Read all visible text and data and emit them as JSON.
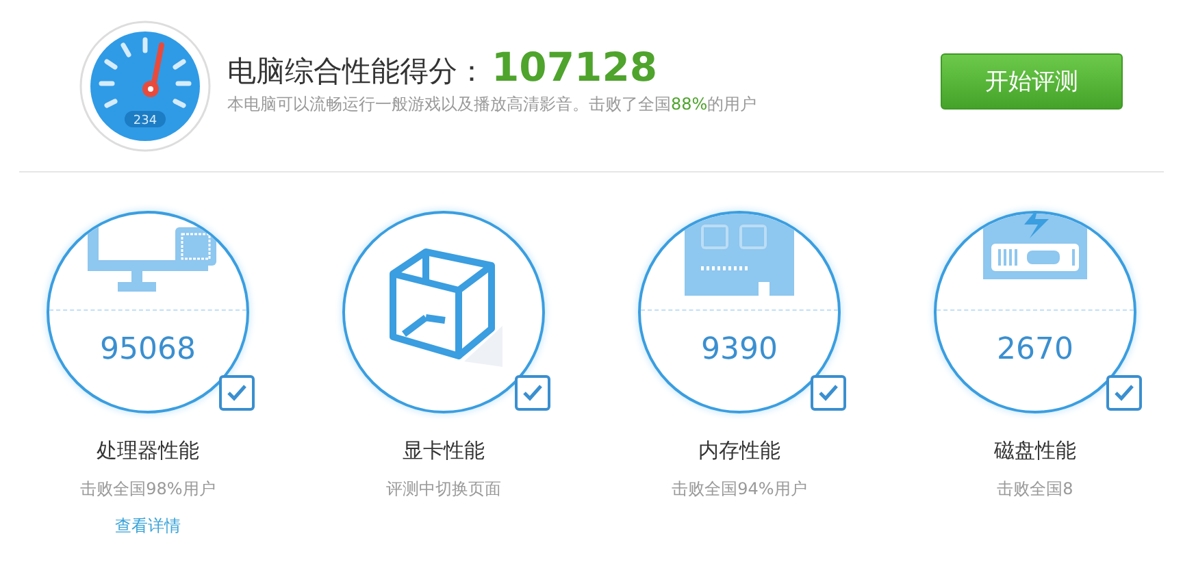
{
  "header": {
    "gauge_reading": "234",
    "title": "电脑综合性能得分：",
    "score": "107128",
    "summary_before": "本电脑可以流畅运行一般游戏以及播放高清影音。击败了全国",
    "summary_percent": "88%",
    "summary_after": "的用户",
    "button": "开始评测"
  },
  "items": [
    {
      "kind": "cpu",
      "score": "95068",
      "checked": true,
      "title": "处理器性能",
      "subtitle": "击败全国98%用户",
      "link": "查看详情"
    },
    {
      "kind": "gpu",
      "checked": true,
      "title": "显卡性能",
      "subtitle": "评测中切换页面"
    },
    {
      "kind": "memory",
      "score": "9390",
      "checked": true,
      "title": "内存性能",
      "subtitle": "击败全国94%用户"
    },
    {
      "kind": "disk",
      "score": "2670",
      "checked": true,
      "title": "磁盘性能",
      "subtitle": "击败全国8"
    }
  ]
}
